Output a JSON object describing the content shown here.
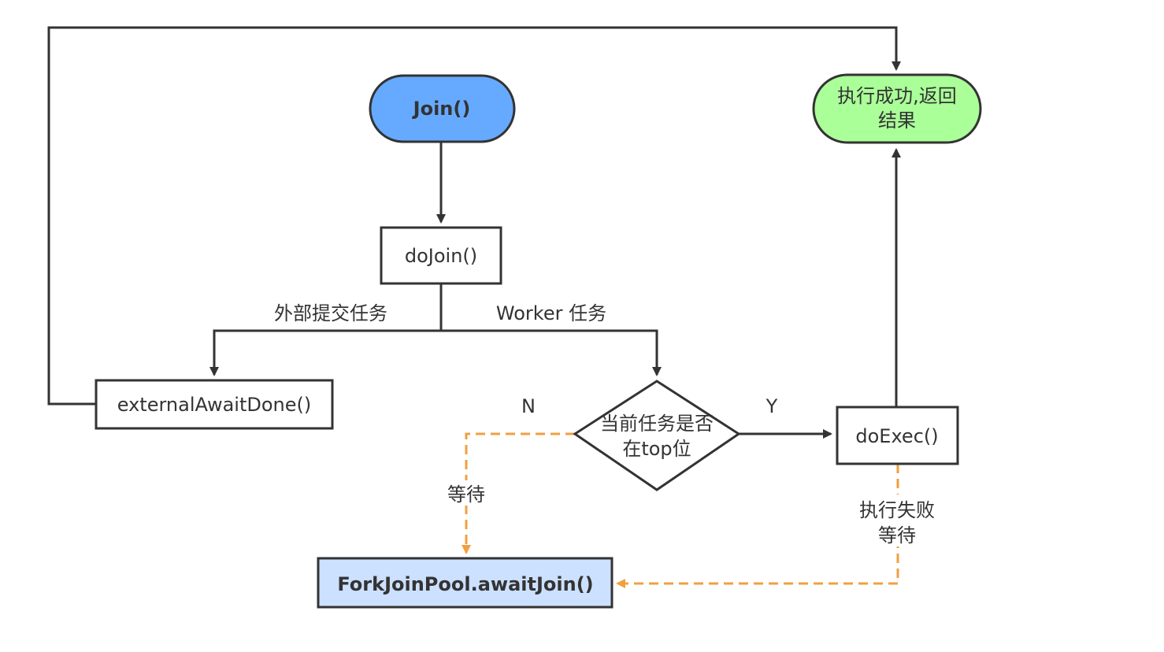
{
  "colors": {
    "stroke": "#333333",
    "start_fill": "#66aaff",
    "success_fill": "#aaff99",
    "await_fill": "#cce0ff",
    "white": "#ffffff",
    "dashed_edge": "#f0a040"
  },
  "nodes": {
    "join": "Join()",
    "do_join": "doJoin()",
    "external_await_done": "externalAwaitDone()",
    "decision_line1": "当前任务是否",
    "decision_line2": "在top位",
    "do_exec": "doExec()",
    "success_line1": "执行成功,返回",
    "success_line2": "结果",
    "await_join": "ForkJoinPool.awaitJoin()"
  },
  "edge_labels": {
    "external_submit": "外部提交任务",
    "worker_task": "Worker 任务",
    "no": "N",
    "yes": "Y",
    "wait": "等待",
    "exec_fail_line1": "执行失败",
    "exec_fail_line2": "等待"
  }
}
